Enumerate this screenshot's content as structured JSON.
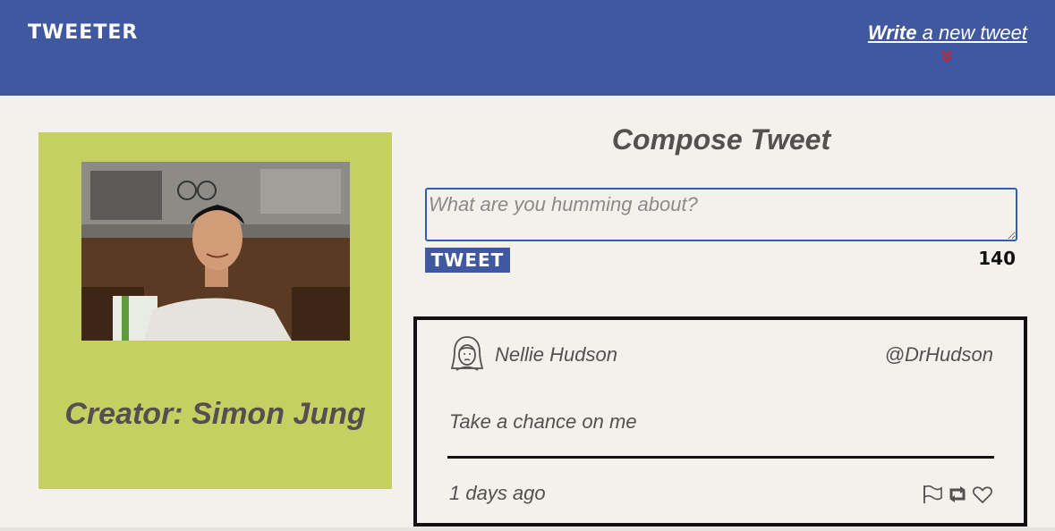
{
  "nav": {
    "brand": "TWEETER",
    "write_strong": "Write",
    "write_rest": " a new tweet",
    "chevron_icon": "double-chevron-down-icon"
  },
  "profile": {
    "photo_alt": "profile-photo",
    "creator": "Creator: Simon Jung"
  },
  "compose": {
    "title": "Compose Tweet",
    "placeholder": "What are you humming about?",
    "value": "",
    "button": "TWEET",
    "counter": "140"
  },
  "tweets": [
    {
      "avatar_icon": "user-avatar-icon",
      "name": "Nellie Hudson",
      "handle": "@DrHudson",
      "content": "Take a chance on me",
      "time": "1 days ago",
      "actions": [
        "flag-icon",
        "retweet-icon",
        "heart-icon"
      ]
    }
  ],
  "colors": {
    "nav": "#4058a0",
    "background": "#f4f1ec",
    "profile_panel": "#c6d062",
    "text": "#545050",
    "accent_chevron": "#c0263a"
  }
}
